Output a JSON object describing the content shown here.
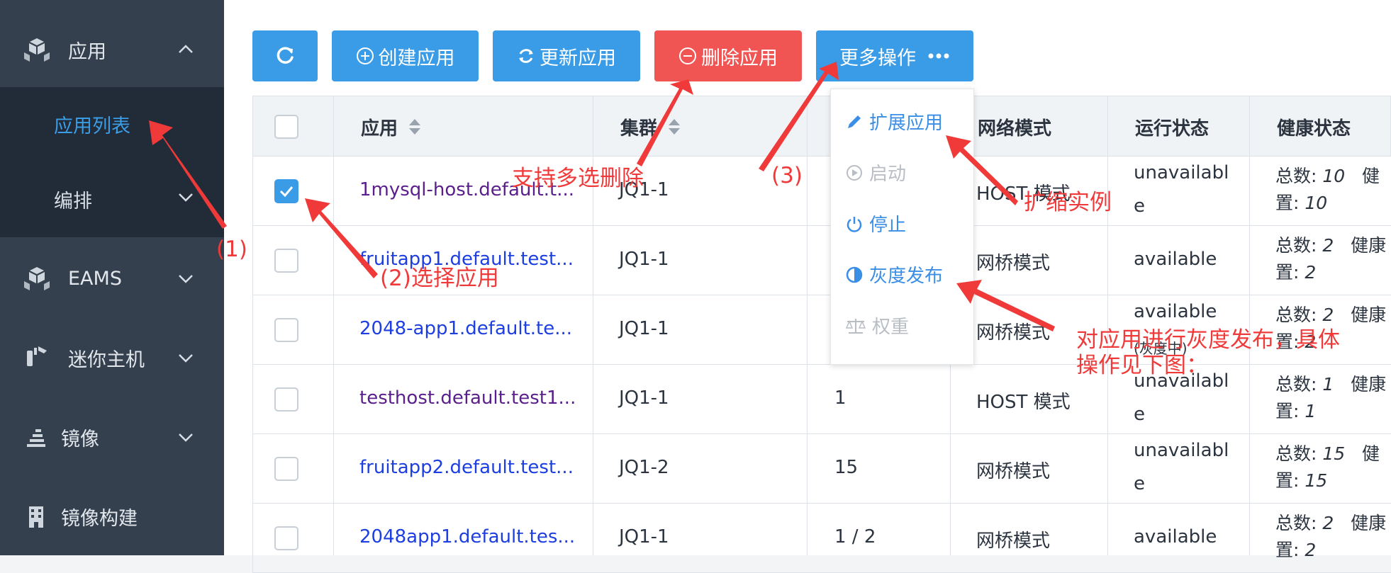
{
  "sidebar": {
    "groups": [
      {
        "label": "应用",
        "icon": "cubes-icon"
      },
      {
        "label": "EAMS",
        "icon": "cubes-icon"
      },
      {
        "label": "迷你主机",
        "icon": "wrench-icon"
      },
      {
        "label": "镜像",
        "icon": "layers-icon"
      },
      {
        "label": "镜像构建",
        "icon": "building-icon"
      }
    ],
    "sub_items": [
      {
        "label": "应用列表",
        "active": true
      },
      {
        "label": "编排",
        "active": false
      }
    ]
  },
  "toolbar": {
    "refresh_icon": "refresh-icon",
    "create_label": "创建应用",
    "update_label": "更新应用",
    "delete_label": "删除应用",
    "more_label": "更多操作"
  },
  "table": {
    "headers": [
      "应用",
      "集群",
      "网络模式",
      "运行状态",
      "健康状态"
    ],
    "rows": [
      {
        "app": "1mysql-host.default.t...",
        "visited": true,
        "cluster": "JQ1-1",
        "instances": "",
        "network": "HOST 模式",
        "status": [
          "unavailabl",
          "e"
        ],
        "health_total_label": "总数:",
        "health_total": "10",
        "health_extra": "健",
        "health_cfg_label": "置:",
        "health_cfg": "10",
        "checked": true
      },
      {
        "app": "fruitapp1.default.test...",
        "visited": false,
        "cluster": "JQ1-1",
        "instances": "",
        "network": "网桥模式",
        "status": [
          "available"
        ],
        "health_total_label": "总数:",
        "health_total": "2",
        "health_extra": "健康",
        "health_cfg_label": "置:",
        "health_cfg": "2",
        "checked": false
      },
      {
        "app": "2048-app1.default.te...",
        "visited": false,
        "cluster": "JQ1-1",
        "instances": "",
        "network": "网桥模式",
        "status": [
          "available",
          "(灰度中)"
        ],
        "health_total_label": "总数:",
        "health_total": "2",
        "health_extra": "健康",
        "health_cfg_label": "置:",
        "health_cfg": "2",
        "checked": false
      },
      {
        "app": "testhost.default.test1...",
        "visited": true,
        "cluster": "JQ1-1",
        "instances": "1",
        "network": "HOST 模式",
        "status": [
          "unavailabl",
          "e"
        ],
        "health_total_label": "总数:",
        "health_total": "1",
        "health_extra": "健康",
        "health_cfg_label": "置:",
        "health_cfg": "1",
        "checked": false
      },
      {
        "app": "fruitapp2.default.test...",
        "visited": false,
        "cluster": "JQ1-2",
        "instances": "15",
        "network": "网桥模式",
        "status": [
          "unavailabl",
          "e"
        ],
        "health_total_label": "总数:",
        "health_total": "15",
        "health_extra": "健",
        "health_cfg_label": "置:",
        "health_cfg": "15",
        "checked": false
      },
      {
        "app": "2048app1.default.tes...",
        "visited": false,
        "cluster": "JQ1-1",
        "instances": "1 / 2",
        "network": "网桥模式",
        "status": [
          "available"
        ],
        "health_total_label": "总数:",
        "health_total": "2",
        "health_extra": "健康",
        "health_cfg_label": "置:",
        "health_cfg": "2",
        "checked": false
      }
    ]
  },
  "dropdown": {
    "items": [
      {
        "label": "扩展应用",
        "icon": "pencil-icon",
        "enabled": true
      },
      {
        "label": "启动",
        "icon": "play-circle-icon",
        "enabled": false
      },
      {
        "label": "停止",
        "icon": "power-icon",
        "enabled": true
      },
      {
        "label": "灰度发布",
        "icon": "half-circle-icon",
        "enabled": true
      },
      {
        "label": "权重",
        "icon": "balance-scale-icon",
        "enabled": false
      }
    ]
  },
  "annotations": {
    "step1": "(1)",
    "step2": "(2)选择应用",
    "step3": "(3)",
    "delete_note": "支持多选删除",
    "scale_note": "扩缩实例",
    "gray_note_line1": "对应用进行灰度发布，具体",
    "gray_note_line2": "操作见下图："
  },
  "colors": {
    "sidebar_bg": "#35404f",
    "sidebar_sub_bg": "#222b38",
    "primary": "#3a9ce6",
    "danger": "#f05554",
    "annotation": "#f03a3a"
  }
}
